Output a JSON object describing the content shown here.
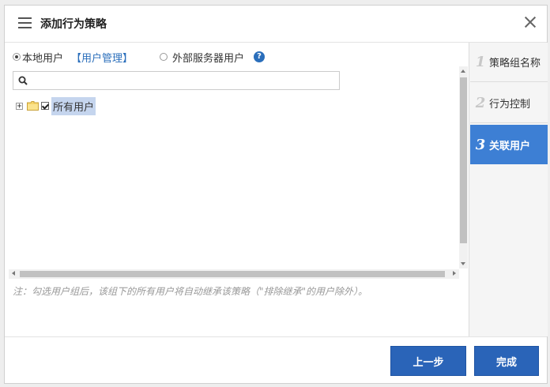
{
  "dialog": {
    "title": "添加行为策略"
  },
  "user_source": {
    "local_label": "本地用户",
    "manage_link": "【用户管理】",
    "external_label": "外部服务器用户",
    "help_glyph": "?",
    "selected": "本地用户"
  },
  "search": {
    "value": "",
    "placeholder": ""
  },
  "tree": {
    "expander_glyph": "+",
    "root_label": "所有用户",
    "root_checked": true
  },
  "note": "注：勾选用户组后，该组下的所有用户将自动继承该策略（\"排除继承\"的用户除外）。",
  "steps": [
    {
      "num": "1",
      "label": "策略组名称",
      "active": false
    },
    {
      "num": "2",
      "label": "行为控制",
      "active": false
    },
    {
      "num": "3",
      "label": "关联用户",
      "active": true
    }
  ],
  "footer": {
    "prev_label": "上一步",
    "done_label": "完成"
  },
  "colors": {
    "accent": "#3d7fd4",
    "button": "#2a64b8",
    "link": "#2a6ebb",
    "selection": "#c5d5ee"
  }
}
